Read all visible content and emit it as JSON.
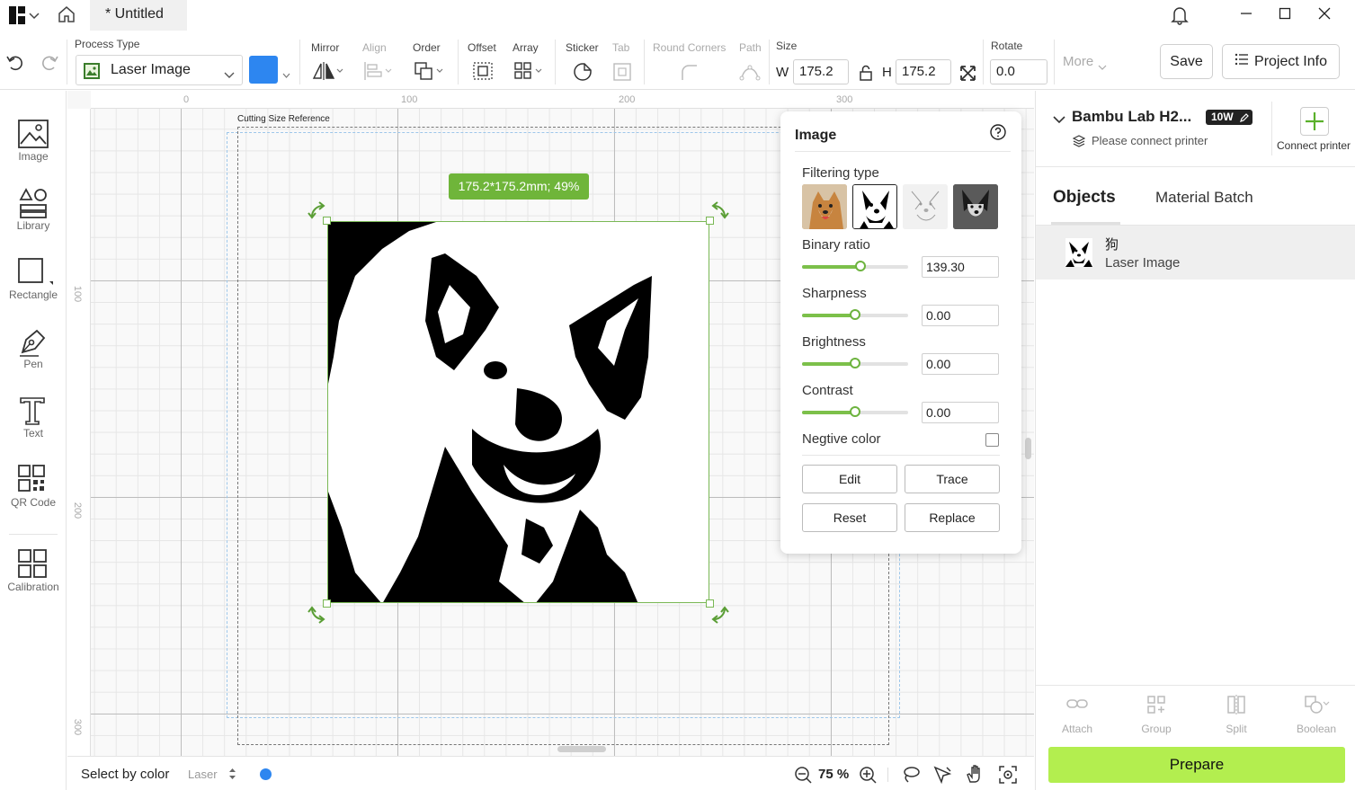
{
  "title_bar": {
    "doc_tab": "* Untitled"
  },
  "toolbar": {
    "process_type_label": "Process Type",
    "process_type_value": "Laser Image",
    "layer_color": "#2d86f0",
    "mirror_label": "Mirror",
    "align_label": "Align",
    "order_label": "Order",
    "offset_label": "Offset",
    "array_label": "Array",
    "sticker_label": "Sticker",
    "tab_label": "Tab",
    "round_corners_label": "Round Corners",
    "path_label": "Path",
    "size_label": "Size",
    "w_label": "W",
    "w_value": "175.2",
    "h_label": "H",
    "h_value": "175.2",
    "rotate_label": "Rotate",
    "rotate_value": "0.0",
    "more_label": "More",
    "save_label": "Save",
    "project_info_label": "Project Info"
  },
  "left_tools": [
    {
      "label": "Image"
    },
    {
      "label": "Library"
    },
    {
      "label": "Rectangle"
    },
    {
      "label": "Pen"
    },
    {
      "label": "Text"
    },
    {
      "label": "QR Code"
    },
    {
      "label": "Calibration"
    }
  ],
  "canvas": {
    "ruler_h": [
      "0",
      "100",
      "200",
      "300"
    ],
    "ruler_v": [
      "100",
      "200",
      "300"
    ],
    "cutting_ref_label": "Cutting Size Reference",
    "size_badge": "175.2*175.2mm; 49%"
  },
  "status_bar": {
    "select_by_color": "Select by color",
    "laser_label": "Laser",
    "zoom": "75 %"
  },
  "image_panel": {
    "title": "Image",
    "filtering_type_label": "Filtering type",
    "binary_ratio_label": "Binary ratio",
    "binary_ratio_value": "139.30",
    "binary_ratio_fraction": 0.55,
    "sharpness_label": "Sharpness",
    "sharpness_value": "0.00",
    "sharpness_fraction": 0.5,
    "brightness_label": "Brightness",
    "brightness_value": "0.00",
    "brightness_fraction": 0.5,
    "contrast_label": "Contrast",
    "contrast_value": "0.00",
    "contrast_fraction": 0.5,
    "negative_color_label": "Negtive color",
    "edit_label": "Edit",
    "trace_label": "Trace",
    "reset_label": "Reset",
    "replace_label": "Replace"
  },
  "right_panel": {
    "printer_name": "Bambu Lab H2...",
    "printer_badge": "10W",
    "printer_status": "Please connect printer",
    "connect_printer_label": "Connect printer",
    "tab_objects": "Objects",
    "tab_material_batch": "Material Batch",
    "object_name": "狗",
    "object_type": "Laser Image",
    "attach_label": "Attach",
    "group_label": "Group",
    "split_label": "Split",
    "boolean_label": "Boolean",
    "prepare_label": "Prepare",
    "prepare_color": "#b3ee4f"
  }
}
